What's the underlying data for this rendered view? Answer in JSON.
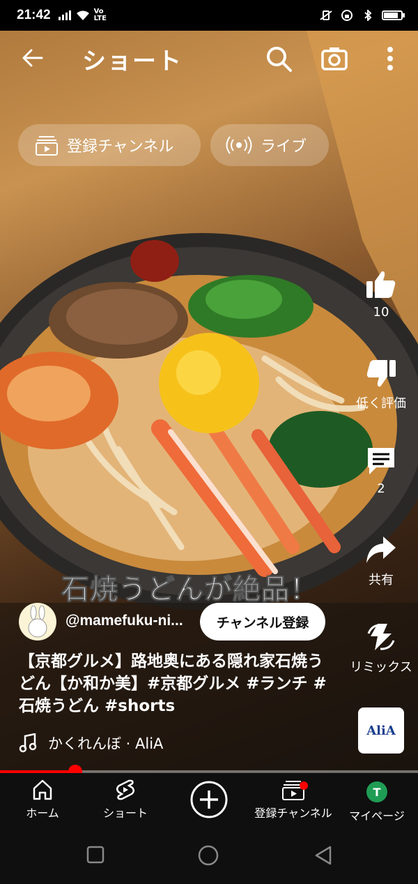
{
  "status_bar": {
    "time": "21:42",
    "network_label": "Vo LTE"
  },
  "header": {
    "title": "ショート",
    "back_icon": "arrow-left-icon",
    "search_icon": "search-icon",
    "camera_icon": "camera-icon",
    "more_icon": "more-vert-icon"
  },
  "chips": [
    {
      "label": "登録チャンネル",
      "icon": "subscriptions-icon"
    },
    {
      "label": "ライブ",
      "icon": "live-icon"
    }
  ],
  "actions": {
    "like_count": "10",
    "dislike_label": "低く評価",
    "comment_count": "2",
    "share_label": "共有",
    "remix_label": "リミックス",
    "sound_thumb_text": "AliA"
  },
  "video": {
    "overlay_caption": "石焼うどんが絶品！",
    "channel_handle": "@mamefuku-ni...",
    "subscribe_label": "チャンネル登録",
    "title": "【京都グルメ】路地奥にある隠れ家石焼うどん【か和か美】#京都グルメ #ランチ #石焼うどん #shorts",
    "music": "かくれんぼ · AliA",
    "progress": 0.18
  },
  "bottom_nav": {
    "items": [
      {
        "label": "ホーム",
        "icon": "home-icon"
      },
      {
        "label": "ショート",
        "icon": "shorts-icon"
      },
      {
        "label": "",
        "icon": "create-plus-icon"
      },
      {
        "label": "登録チャンネル",
        "icon": "subscriptions-icon"
      },
      {
        "label": "マイページ",
        "icon": "avatar"
      }
    ],
    "avatar_initial": "T"
  },
  "colors": {
    "accent": "#ff0000",
    "nav_bg": "#0f0f0f",
    "avatar_bg": "#1f9d55"
  }
}
